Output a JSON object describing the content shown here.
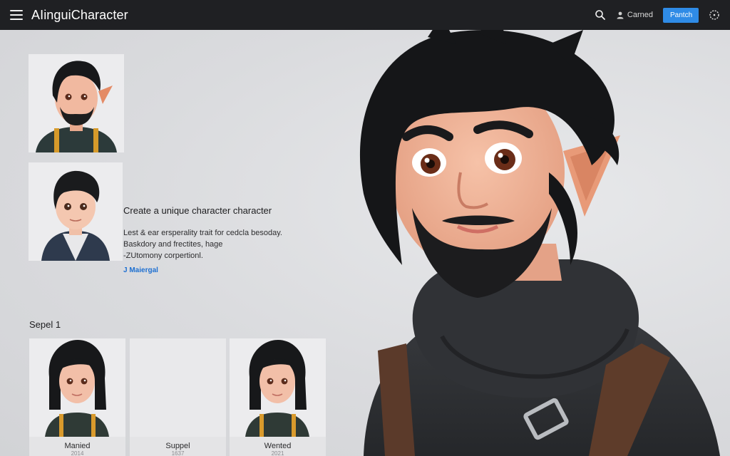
{
  "app": {
    "title": "AIinguiCharacter"
  },
  "header": {
    "account_label": "Carned",
    "publish_label": "Pantch"
  },
  "icons": {
    "menu": "menu-icon",
    "search": "search-icon",
    "user": "user-icon",
    "settings": "settings-icon"
  },
  "colors": {
    "topbar": "#1f2023",
    "accent": "#2f8be6",
    "link": "#1d6fd1",
    "background": "#dcdde0"
  },
  "character_info": {
    "title": "Create a unique character character",
    "description_lines": [
      "Lest & ear ersperality trait for cedcla besoday.",
      "Baskdory and frectites, hage",
      "-ZUtomony corpertionl."
    ],
    "link_label": "J Maiergal"
  },
  "gallery": {
    "section_label": "Sepel 1",
    "cards": [
      {
        "name": "Manied",
        "year": "2014"
      },
      {
        "name": "Suppel",
        "year": "1637"
      },
      {
        "name": "Wented",
        "year": "2021"
      }
    ]
  }
}
